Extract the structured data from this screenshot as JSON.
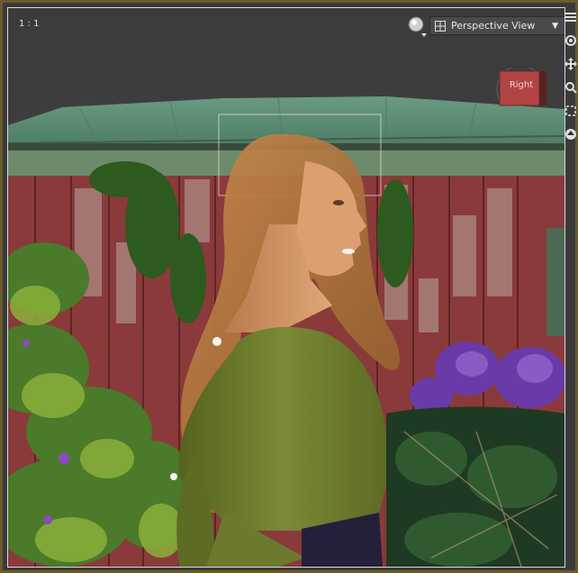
{
  "viewport": {
    "ratio_label": "1 : 1",
    "view_selector": {
      "label": "Perspective View",
      "dropdown_icon": "chevron-down-icon"
    },
    "shading_icon": "sphere-shading-icon",
    "view_cube": {
      "label": "Right"
    }
  },
  "toolbar": {
    "icons": [
      "panel-menu-icon",
      "orbit-icon",
      "pan-icon",
      "zoom-icon",
      "frame-icon",
      "reset-camera-icon"
    ]
  },
  "colors": {
    "frame": "#6b5a2a",
    "background": "#3e3e3e",
    "roof": "#5a8a72",
    "fence": "#8a3a3a",
    "dress": "#6a7a2e",
    "hair": "#b07a42",
    "skin": "#d89a6a",
    "flowers": "#7a4ac0",
    "foliage": "#4a7a2a"
  }
}
